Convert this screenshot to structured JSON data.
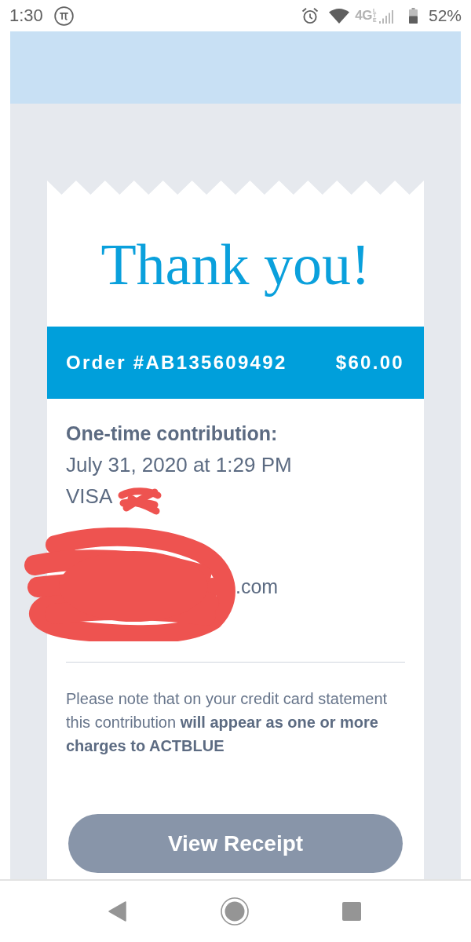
{
  "status_bar": {
    "time": "1:30",
    "network": "4G",
    "network_detail": "LTE",
    "battery": "52%"
  },
  "receipt": {
    "title": "Thank you!",
    "order": {
      "number": "Order #AB135609492",
      "amount": "$60.00"
    },
    "details": [
      {
        "kind": "heading",
        "text": "One-time contribution:",
        "redacted": false
      },
      {
        "kind": "text",
        "text": "July 31, 2020 at 1:29 PM",
        "redacted": false
      },
      {
        "kind": "text",
        "text": "VISA",
        "redacted": true
      },
      {
        "kind": "contact",
        "text": ".com",
        "redacted": true
      }
    ],
    "note": "Please note that on your credit card statement this contribution **will appear as one or more charges to ACTBLUE**",
    "button": {
      "label": "View Receipt"
    }
  },
  "nav_bar": {
    "buttons": [
      {
        "kind": "back"
      },
      {
        "kind": "home"
      },
      {
        "kind": "recents"
      }
    ]
  }
}
